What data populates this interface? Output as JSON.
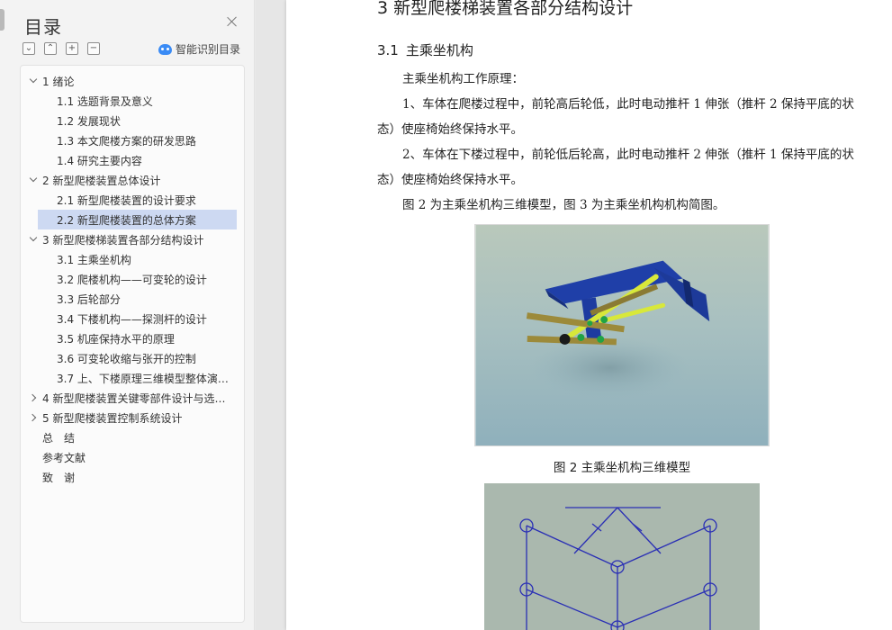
{
  "toc": {
    "title": "目录",
    "ai_label": "智能识别目录",
    "tools": [
      "⌄",
      "⌃",
      "+",
      "−"
    ],
    "items": [
      {
        "label": "1 绪论",
        "level": 1,
        "expanded": true
      },
      {
        "label": "1.1  选题背景及意义",
        "level": 2
      },
      {
        "label": "1.2  发展现状",
        "level": 2
      },
      {
        "label": "1.3  本文爬楼方案的研发思路",
        "level": 2
      },
      {
        "label": "1.4  研究主要内容",
        "level": 2
      },
      {
        "label": "2 新型爬楼装置总体设计",
        "level": 1,
        "expanded": true
      },
      {
        "label": "2.1  新型爬楼装置的设计要求",
        "level": 2
      },
      {
        "label": "2.2  新型爬楼装置的总体方案",
        "level": 2,
        "selected": true
      },
      {
        "label": "3 新型爬楼梯装置各部分结构设计",
        "level": 1,
        "expanded": true
      },
      {
        "label": "3.1  主乘坐机构",
        "level": 2
      },
      {
        "label": "3.2  爬楼机构——可变轮的设计",
        "level": 2
      },
      {
        "label": "3.3  后轮部分",
        "level": 2
      },
      {
        "label": "3.4 下楼机构——探测杆的设计",
        "level": 2
      },
      {
        "label": "3.5  机座保持水平的原理",
        "level": 2
      },
      {
        "label": "3.6  可变轮收缩与张开的控制",
        "level": 2
      },
      {
        "label": "3.7  上、下楼原理三维模型整体演…",
        "level": 2
      },
      {
        "label": "4 新型爬楼装置关键零部件设计与选…",
        "level": 1,
        "expanded": false
      },
      {
        "label": "5 新型爬楼装置控制系统设计",
        "level": 1,
        "expanded": false
      },
      {
        "label": "总　结",
        "level": 1,
        "leaf": true
      },
      {
        "label": "参考文献",
        "level": 1,
        "leaf": true
      },
      {
        "label": "致　谢",
        "level": 1,
        "leaf": true
      }
    ]
  },
  "doc": {
    "chapter_title": "3 新型爬楼梯装置各部分结构设计",
    "section_num": "3.1",
    "section_title": "主乘坐机构",
    "p1": "主乘坐机构工作原理：",
    "p2": "1、车体在爬楼过程中，前轮高后轮低，此时电动推杆 1 伸张（推杆 2 保持平底的状态）使座椅始终保持水平。",
    "p3": "2、车体在下楼过程中，前轮低后轮高，此时电动推杆 2 伸张（推杆 1 保持平底的状态）使座椅始终保持水平。",
    "p4": "图 2 为主乘坐机构三维模型，图 3 为主乘坐机构机构简图。",
    "caption1": "图 2  主乘坐机构三维模型"
  },
  "colors": {
    "selected_bg": "#cdd9f2",
    "accent": "#3a8bf5",
    "model_blue": "#1f3fa8",
    "model_yellow": "#d8e83a"
  }
}
